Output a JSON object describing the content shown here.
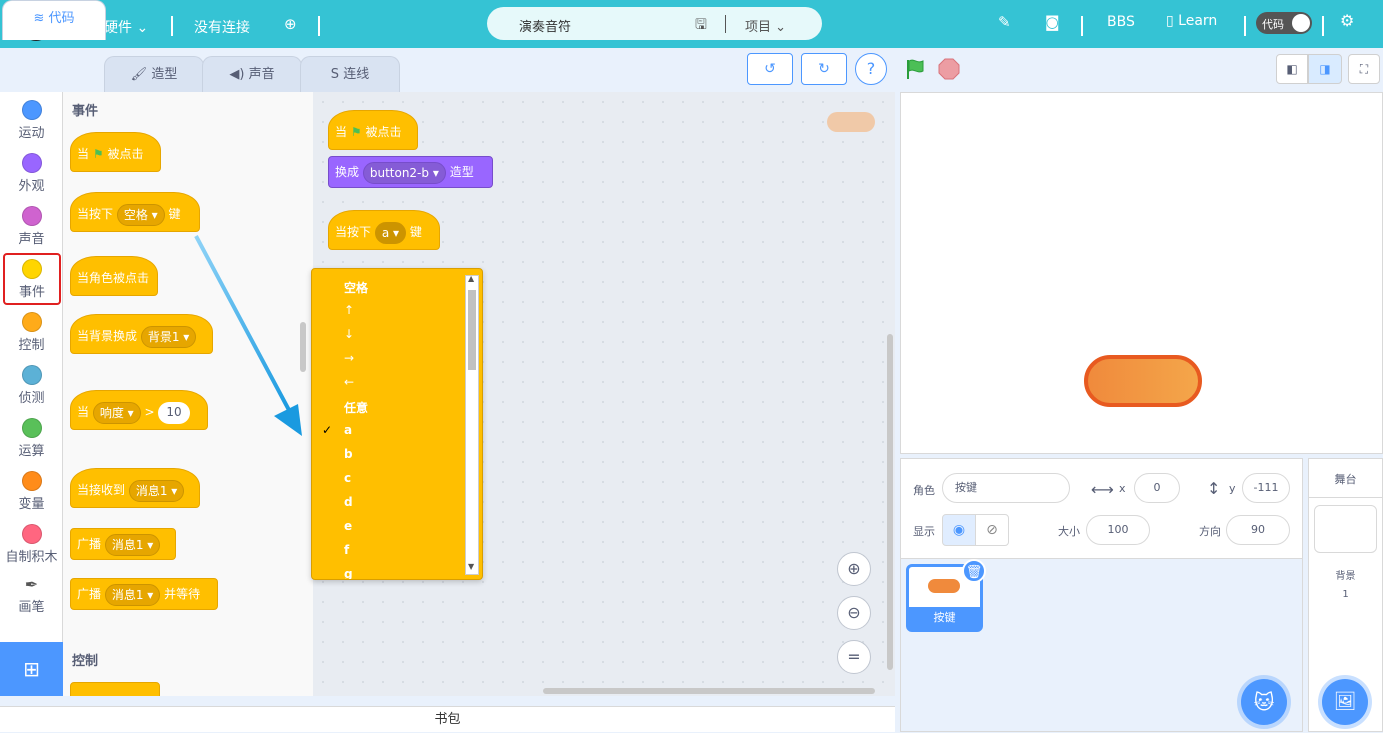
{
  "topbar": {
    "hardware": "没有硬件",
    "connection": "没有连接",
    "project_name": "演奏音符",
    "project_menu": "项目",
    "bbs": "BBS",
    "learn": "Learn",
    "code_toggle": "代码",
    "bg_color": "#35c3d4"
  },
  "tabs": [
    {
      "label": "代码",
      "icon": "code-blocks-icon"
    },
    {
      "label": "造型",
      "icon": "brush-icon"
    },
    {
      "label": "声音",
      "icon": "speaker-icon"
    },
    {
      "label": "连线",
      "icon": "wire-icon"
    }
  ],
  "categories": [
    {
      "label": "运动",
      "color": "#4c97ff"
    },
    {
      "label": "外观",
      "color": "#9966ff"
    },
    {
      "label": "声音",
      "color": "#cf63cf"
    },
    {
      "label": "事件",
      "color": "#ffd500"
    },
    {
      "label": "控制",
      "color": "#ffab19"
    },
    {
      "label": "侦测",
      "color": "#5cb1d6"
    },
    {
      "label": "运算",
      "color": "#59c059"
    },
    {
      "label": "变量",
      "color": "#ff8c1a"
    },
    {
      "label": "自制积木",
      "color": "#ff6680"
    },
    {
      "label": "画笔",
      "color": "#0fbd8c"
    }
  ],
  "palette": {
    "section_events": "事件",
    "section_control": "控制",
    "b1_when": "当",
    "b1_clicked": "被点击",
    "b2_when_key": "当按下",
    "b2_key": "空格",
    "b2_suffix": "键",
    "b3": "当角色被点击",
    "b4_prefix": "当背景换成",
    "b4_val": "背景1",
    "b5_when": "当",
    "b5_sensor": "响度",
    "b5_op": ">",
    "b5_val": "10",
    "b6_prefix": "当接收到",
    "b6_val": "消息1",
    "b7_prefix": "广播",
    "b7_val": "消息1",
    "b8_prefix": "广播",
    "b8_val": "消息1",
    "b8_suffix": "并等待"
  },
  "script": {
    "s1_when": "当",
    "s1_clicked": "被点击",
    "s2_switch": "换成",
    "s2_costume": "button2-b",
    "s2_suffix": "造型",
    "s3_when_key": "当按下",
    "s3_key": "a",
    "s3_suffix": "键"
  },
  "dropdown": {
    "items": [
      "空格",
      "↑",
      "↓",
      "→",
      "←",
      "任意",
      "a",
      "b",
      "c",
      "d",
      "e",
      "f",
      "g"
    ],
    "selected": "a",
    "check": "✓"
  },
  "sprite_info": {
    "sprite_label": "角色",
    "sprite_name": "按键",
    "x_label": "x",
    "x_value": "0",
    "y_label": "y",
    "y_value": "-111",
    "show_label": "显示",
    "size_label": "大小",
    "size_value": "100",
    "direction_label": "方向",
    "direction_value": "90"
  },
  "sprite_list": [
    {
      "name": "按键"
    }
  ],
  "stage_panel": {
    "title": "舞台",
    "backdrop_label": "背景",
    "backdrop_count": "1"
  },
  "bookbag": "书包"
}
